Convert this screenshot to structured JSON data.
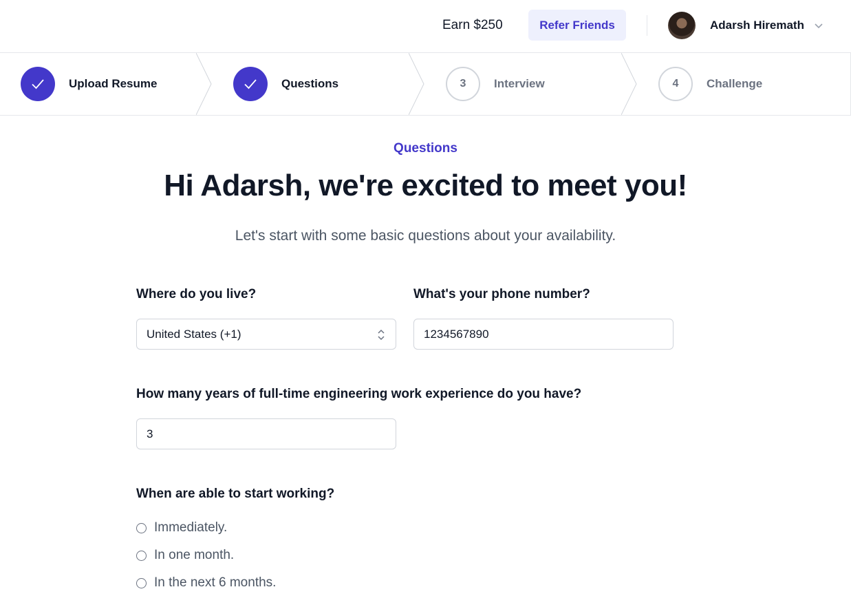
{
  "header": {
    "earn_text": "Earn $250",
    "refer_label": "Refer Friends",
    "user_name": "Adarsh Hiremath"
  },
  "steps": [
    {
      "number": "1",
      "label": "Upload Resume",
      "status": "complete"
    },
    {
      "number": "2",
      "label": "Questions",
      "status": "complete"
    },
    {
      "number": "3",
      "label": "Interview",
      "status": "upcoming"
    },
    {
      "number": "4",
      "label": "Challenge",
      "status": "upcoming"
    }
  ],
  "page": {
    "eyebrow": "Questions",
    "title": "Hi Adarsh, we're excited to meet you!",
    "subtitle": "Let's start with some basic questions about your availability."
  },
  "form": {
    "location": {
      "label": "Where do you live?",
      "value": "United States (+1)"
    },
    "phone": {
      "label": "What's your phone number?",
      "value": "1234567890"
    },
    "experience": {
      "label": "How many years of full-time engineering work experience do you have?",
      "value": "3"
    },
    "start": {
      "label": "When are able to start working?",
      "options": [
        "Immediately.",
        "In one month.",
        "In the next 6 months."
      ]
    }
  },
  "colors": {
    "accent": "#4338ca",
    "accent_light": "#eef0fd",
    "border": "#e5e7eb",
    "muted_text": "#6b7280"
  }
}
